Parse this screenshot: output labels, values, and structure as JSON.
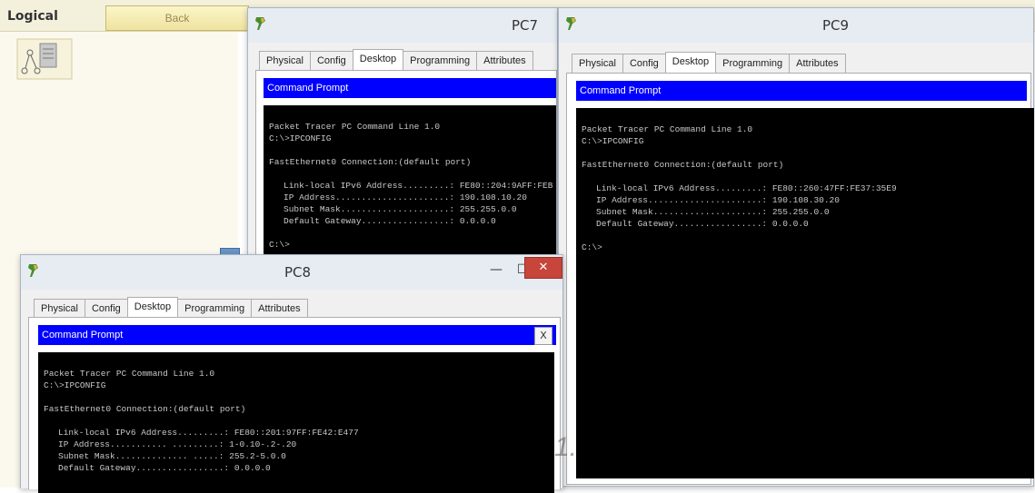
{
  "workspace": {
    "mode_label": "Logical",
    "back_label": "Back",
    "tool_icon": "logical-topology-icon"
  },
  "pc7": {
    "title": "PC7",
    "tabs": [
      "Physical",
      "Config",
      "Desktop",
      "Programming",
      "Attributes"
    ],
    "active_tab": "Desktop",
    "panel_title": "Command Prompt",
    "console": {
      "l1": "Packet Tracer PC Command Line 1.0",
      "l2": "C:\\>IPCONFIG",
      "l3": "FastEthernet0 Connection:(default port)",
      "l4": "Link-local IPv6 Address.........: FE80::204:9AFF:FEB",
      "l5": "IP Address......................: 190.108.10.20",
      "l6": "Subnet Mask.....................: 255.255.0.0",
      "l7": "Default Gateway.................: 0.0.0.0",
      "l8": "C:\\>"
    }
  },
  "pc9": {
    "title": "PC9",
    "tabs": [
      "Physical",
      "Config",
      "Desktop",
      "Programming",
      "Attributes"
    ],
    "active_tab": "Desktop",
    "panel_title": "Command Prompt",
    "console": {
      "l1": "Packet Tracer PC Command Line 1.0",
      "l2": "C:\\>IPCONFIG",
      "l3": "FastEthernet0 Connection:(default port)",
      "l4": "Link-local IPv6 Address.........: FE80::260:47FF:FE37:35E9",
      "l5": "IP Address......................: 190.108.30.20",
      "l6": "Subnet Mask.....................: 255.255.0.0",
      "l7": "Default Gateway.................: 0.0.0.0",
      "l8": "C:\\>"
    }
  },
  "pc8": {
    "title": "PC8",
    "tabs": [
      "Physical",
      "Config",
      "Desktop",
      "Programming",
      "Attributes"
    ],
    "active_tab": "Desktop",
    "panel_title": "Command Prompt",
    "close_label": "X",
    "window_controls": {
      "minimize": "—",
      "maximize": "☐",
      "close": "✕"
    },
    "console": {
      "l1": "Packet Tracer PC Command Line 1.0",
      "l2": "C:\\>IPCONFIG",
      "l3": "FastEthernet0 Connection:(default port)",
      "l4": "Link-local IPv6 Address.........: FE80::201:97FF:FE42:E477",
      "l5": "IP Address........... .........: 1-0.10-.2-.20",
      "l6": "Subnet Mask.............. .....: 255.2-5.0.0",
      "l7": "Default Gateway.................: 0.0.0.0"
    }
  },
  "overlay": {
    "watermark": "1."
  },
  "colors": {
    "cp_header": "#0000ff",
    "console_bg": "#000000",
    "close_button": "#c7453b"
  }
}
